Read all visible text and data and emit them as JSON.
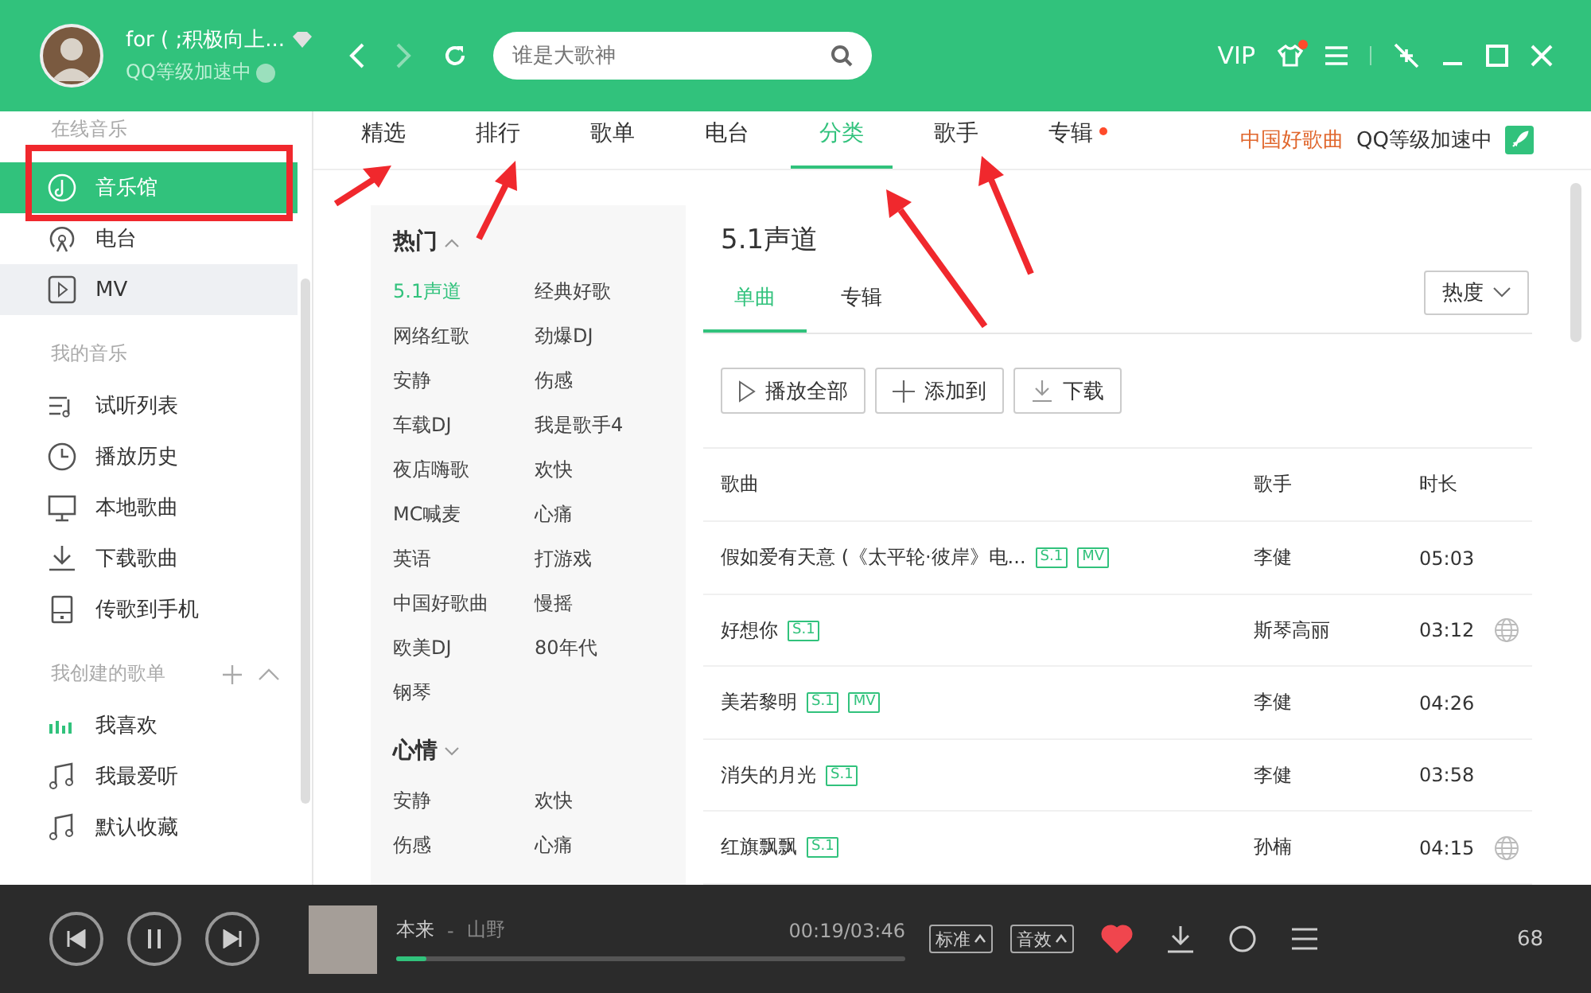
{
  "header": {
    "user_name": "for ( ;积极向上...",
    "user_status": "QQ等级加速中",
    "search_placeholder": "谁是大歌神",
    "vip": "VIP",
    "skin_dot": true
  },
  "tabs": [
    {
      "label": "精选",
      "selected": false,
      "dot": false
    },
    {
      "label": "排行",
      "selected": false,
      "dot": false
    },
    {
      "label": "歌单",
      "selected": false,
      "dot": false
    },
    {
      "label": "电台",
      "selected": false,
      "dot": false
    },
    {
      "label": "分类",
      "selected": true,
      "dot": false
    },
    {
      "label": "歌手",
      "selected": false,
      "dot": false
    },
    {
      "label": "专辑",
      "selected": false,
      "dot": true
    }
  ],
  "tab_links": [
    {
      "label": "中国好歌曲",
      "kind": "promo"
    },
    {
      "label": "QQ等级加速中",
      "kind": "speed"
    }
  ],
  "sidebar": [
    {
      "title": "在线音乐",
      "tools": false,
      "items": [
        {
          "label": "音乐馆",
          "kind": "hall",
          "selected": true,
          "hovered": false
        },
        {
          "label": "电台",
          "kind": "radio",
          "selected": false,
          "hovered": false
        },
        {
          "label": "MV",
          "kind": "mv",
          "selected": false,
          "hovered": true
        }
      ]
    },
    {
      "title": "我的音乐",
      "tools": false,
      "items": [
        {
          "label": "试听列表",
          "kind": "playlist",
          "selected": false,
          "hovered": false
        },
        {
          "label": "播放历史",
          "kind": "history",
          "selected": false,
          "hovered": false
        },
        {
          "label": "本地歌曲",
          "kind": "local",
          "selected": false,
          "hovered": false
        },
        {
          "label": "下载歌曲",
          "kind": "download",
          "selected": false,
          "hovered": false
        },
        {
          "label": "传歌到手机",
          "kind": "phone",
          "selected": false,
          "hovered": false
        }
      ]
    },
    {
      "title": "我创建的歌单",
      "tools": true,
      "items": [
        {
          "label": "我喜欢",
          "kind": "bars",
          "selected": false,
          "hovered": false
        },
        {
          "label": "我最爱听",
          "kind": "note",
          "selected": false,
          "hovered": false
        },
        {
          "label": "默认收藏",
          "kind": "note",
          "selected": false,
          "hovered": false
        }
      ]
    }
  ],
  "categories": [
    {
      "title": "热门",
      "expanded": true,
      "items": [
        {
          "label": "5.1声道",
          "selected": true
        },
        {
          "label": "经典好歌",
          "selected": false
        },
        {
          "label": "网络红歌",
          "selected": false
        },
        {
          "label": "劲爆DJ",
          "selected": false
        },
        {
          "label": "安静",
          "selected": false
        },
        {
          "label": "伤感",
          "selected": false
        },
        {
          "label": "车载DJ",
          "selected": false
        },
        {
          "label": "我是歌手4",
          "selected": false
        },
        {
          "label": "夜店嗨歌",
          "selected": false
        },
        {
          "label": "欢快",
          "selected": false
        },
        {
          "label": "MC喊麦",
          "selected": false
        },
        {
          "label": "心痛",
          "selected": false
        },
        {
          "label": "英语",
          "selected": false
        },
        {
          "label": "打游戏",
          "selected": false
        },
        {
          "label": "中国好歌曲",
          "selected": false
        },
        {
          "label": "慢摇",
          "selected": false
        },
        {
          "label": "欧美DJ",
          "selected": false
        },
        {
          "label": "80年代",
          "selected": false
        },
        {
          "label": "钢琴",
          "selected": false
        }
      ]
    },
    {
      "title": "心情",
      "expanded": false,
      "items": [
        {
          "label": "安静",
          "selected": false
        },
        {
          "label": "欢快",
          "selected": false
        },
        {
          "label": "伤感",
          "selected": false
        },
        {
          "label": "心痛",
          "selected": false
        }
      ]
    }
  ],
  "section": {
    "title": "5.1声道",
    "subtabs": [
      {
        "label": "单曲",
        "selected": true
      },
      {
        "label": "专辑",
        "selected": false
      }
    ],
    "sort": "热度",
    "actions": [
      {
        "label": "播放全部",
        "kind": "play"
      },
      {
        "label": "添加到",
        "kind": "add"
      },
      {
        "label": "下载",
        "kind": "download"
      }
    ],
    "columns": [
      "歌曲",
      "歌手",
      "时长"
    ],
    "rows": [
      {
        "title": "假如爱有天意 (《太平轮·彼岸》电...",
        "tags": [
          "S.1",
          "MV"
        ],
        "singer": "李健",
        "duration": "05:03"
      },
      {
        "title": "好想你",
        "tags": [
          "S.1"
        ],
        "singer": "斯琴高丽",
        "duration": "03:12",
        "globe": true
      },
      {
        "title": "美若黎明",
        "tags": [
          "S.1",
          "MV"
        ],
        "singer": "李健",
        "duration": "04:26"
      },
      {
        "title": "消失的月光",
        "tags": [
          "S.1"
        ],
        "singer": "李健",
        "duration": "03:58"
      },
      {
        "title": "红旗飘飘",
        "tags": [
          "S.1"
        ],
        "singer": "孙楠",
        "duration": "04:15",
        "globe": true
      }
    ]
  },
  "player": {
    "song": "本来",
    "separator": "-",
    "artist": "山野",
    "time": "00:19/03:46",
    "level": 0.06,
    "quality": "标准",
    "effect": "音效",
    "liked": true,
    "count": "68"
  }
}
